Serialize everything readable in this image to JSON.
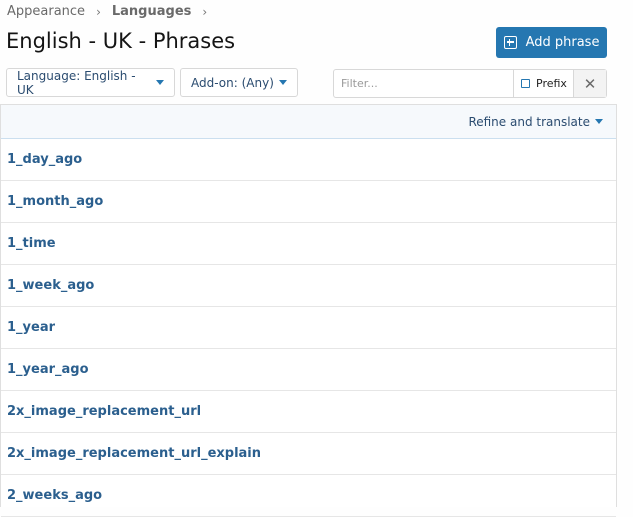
{
  "breadcrumb": {
    "items": [
      "Appearance",
      "Languages"
    ]
  },
  "page": {
    "title": "English - UK - Phrases"
  },
  "toolbar": {
    "add_label": "Add phrase",
    "language_label": "Language: English - UK",
    "addon_label": "Add-on: (Any)"
  },
  "filter": {
    "placeholder": "Filter...",
    "prefix_label": "Prefix",
    "clear_glyph": "✕"
  },
  "list": {
    "header_action": "Refine and translate",
    "phrases": [
      "1_day_ago",
      "1_month_ago",
      "1_time",
      "1_week_ago",
      "1_year",
      "1_year_ago",
      "2x_image_replacement_url",
      "2x_image_replacement_url_explain",
      "2_weeks_ago"
    ]
  },
  "colors": {
    "accent": "#2577b1",
    "link": "#2b5f8e"
  }
}
